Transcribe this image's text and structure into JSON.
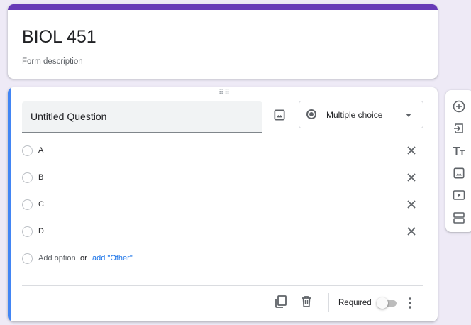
{
  "form": {
    "title": "BIOL 451",
    "description": "Form description",
    "accent_color": "#673ab7"
  },
  "question": {
    "title": "Untitled Question",
    "type": "Multiple choice",
    "options": [
      "A",
      "B",
      "C",
      "D"
    ],
    "add_option_label": "Add option",
    "or_label": "or",
    "add_other_label": "add \"Other\"",
    "required_label": "Required",
    "required": false,
    "active_color": "#4285f4",
    "icons": {
      "image": "image-icon",
      "remove": "close-icon",
      "duplicate": "copy-icon",
      "delete": "trash-icon",
      "more": "more-vert-icon",
      "drag": "drag-handle-icon"
    }
  },
  "toolbar": {
    "items": [
      "add-question-icon",
      "import-questions-icon",
      "add-title-icon",
      "add-image-icon",
      "add-video-icon",
      "add-section-icon"
    ]
  }
}
